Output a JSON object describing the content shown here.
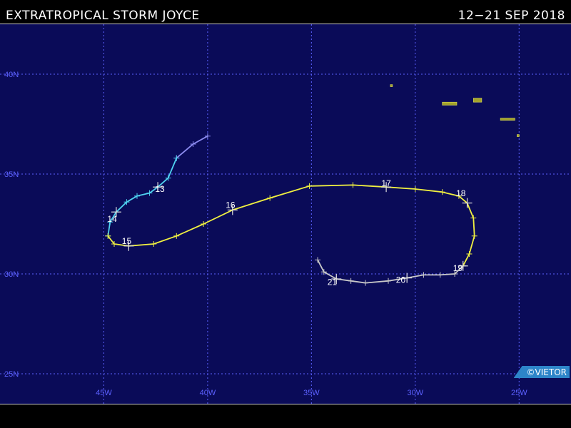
{
  "header": {
    "title": "EXTRATROPICAL STORM JOYCE",
    "date_range": "12−21 SEP 2018"
  },
  "copyright": "©VIETOR",
  "map": {
    "lat_labels": [
      "40N",
      "35N",
      "30N",
      "25N"
    ],
    "lon_labels": [
      "45W",
      "40W",
      "35W",
      "30W",
      "25W"
    ],
    "lat_values": [
      40,
      35,
      30,
      25
    ],
    "lon_values": [
      -45,
      -40,
      -35,
      -30,
      -25
    ],
    "lon_range": [
      -50,
      -22.5
    ],
    "lat_range": [
      23.5,
      42.5
    ],
    "grid_color": "#5c61ff",
    "background_color": "#0a0b58",
    "land_color": "#a3a32a"
  },
  "chart_data": {
    "type": "line",
    "series": [
      {
        "stage": "extratropical",
        "color": "#8c8cf0",
        "points": [
          [
            -40.0,
            36.9
          ],
          [
            -40.7,
            36.5
          ],
          [
            -41.5,
            35.8
          ]
        ]
      },
      {
        "stage": "tropical storm",
        "color": "#4fd2f0",
        "points": [
          [
            -41.5,
            35.8
          ],
          [
            -41.9,
            34.8
          ],
          [
            -42.4,
            34.35
          ],
          [
            -42.8,
            34.05
          ],
          [
            -43.4,
            33.9
          ],
          [
            -43.9,
            33.6
          ],
          [
            -44.4,
            33.1
          ],
          [
            -44.7,
            32.6
          ],
          [
            -44.8,
            31.9
          ]
        ]
      },
      {
        "stage": "hurricane",
        "color": "#f0f040",
        "points": [
          [
            -44.8,
            31.9
          ],
          [
            -44.5,
            31.5
          ],
          [
            -43.8,
            31.4
          ],
          [
            -42.6,
            31.5
          ],
          [
            -41.5,
            31.9
          ],
          [
            -40.2,
            32.5
          ],
          [
            -38.8,
            33.2
          ],
          [
            -37.0,
            33.8
          ],
          [
            -35.1,
            34.4
          ],
          [
            -33.0,
            34.45
          ],
          [
            -31.4,
            34.35
          ],
          [
            -30.0,
            34.25
          ],
          [
            -28.7,
            34.1
          ],
          [
            -27.9,
            33.9
          ],
          [
            -27.5,
            33.55
          ],
          [
            -27.2,
            32.8
          ],
          [
            -27.15,
            31.9
          ],
          [
            -27.4,
            31.0
          ],
          [
            -27.7,
            30.4
          ]
        ]
      },
      {
        "stage": "tropical storm (weakening)",
        "color": "#c8c8c8",
        "points": [
          [
            -27.7,
            30.4
          ],
          [
            -28.1,
            30.0
          ],
          [
            -28.8,
            29.95
          ],
          [
            -29.6,
            29.95
          ],
          [
            -30.4,
            29.8
          ],
          [
            -31.3,
            29.65
          ],
          [
            -32.4,
            29.55
          ],
          [
            -33.1,
            29.65
          ],
          [
            -33.8,
            29.75
          ],
          [
            -34.4,
            30.1
          ],
          [
            -34.7,
            30.7
          ]
        ]
      }
    ],
    "day_labels": [
      {
        "text": "13",
        "lon": -42.3,
        "lat": 34.1
      },
      {
        "text": "14",
        "lon": -44.6,
        "lat": 32.6
      },
      {
        "text": "15",
        "lon": -43.9,
        "lat": 31.5
      },
      {
        "text": "16",
        "lon": -38.9,
        "lat": 33.3
      },
      {
        "text": "17",
        "lon": -31.4,
        "lat": 34.4
      },
      {
        "text": "18",
        "lon": -27.8,
        "lat": 33.9
      },
      {
        "text": "19",
        "lon": -27.95,
        "lat": 30.15
      },
      {
        "text": "20",
        "lon": -30.7,
        "lat": 29.55
      },
      {
        "text": "21",
        "lon": -34.0,
        "lat": 29.45
      }
    ],
    "day_marks": [
      [
        -42.4,
        34.35
      ],
      [
        -44.4,
        33.1
      ],
      [
        -43.8,
        31.4
      ],
      [
        -38.8,
        33.2
      ],
      [
        -31.4,
        34.35
      ],
      [
        -27.5,
        33.55
      ],
      [
        -27.7,
        30.4
      ],
      [
        -30.4,
        29.8
      ],
      [
        -33.8,
        29.75
      ]
    ],
    "islands": [
      {
        "name": "Flores",
        "points": [
          [
            -31.2,
            39.48
          ],
          [
            -31.1,
            39.42
          ]
        ]
      },
      {
        "name": "Faial-Pico",
        "points": [
          [
            -28.7,
            38.6
          ],
          [
            -28.0,
            38.45
          ]
        ]
      },
      {
        "name": "Terceira",
        "points": [
          [
            -27.2,
            38.8
          ],
          [
            -26.8,
            38.6
          ]
        ]
      },
      {
        "name": "Sao Miguel",
        "points": [
          [
            -25.9,
            37.8
          ],
          [
            -25.2,
            37.7
          ]
        ]
      },
      {
        "name": "Santa Maria",
        "points": [
          [
            -25.1,
            36.95
          ],
          [
            -25.05,
            36.98
          ]
        ]
      }
    ]
  }
}
